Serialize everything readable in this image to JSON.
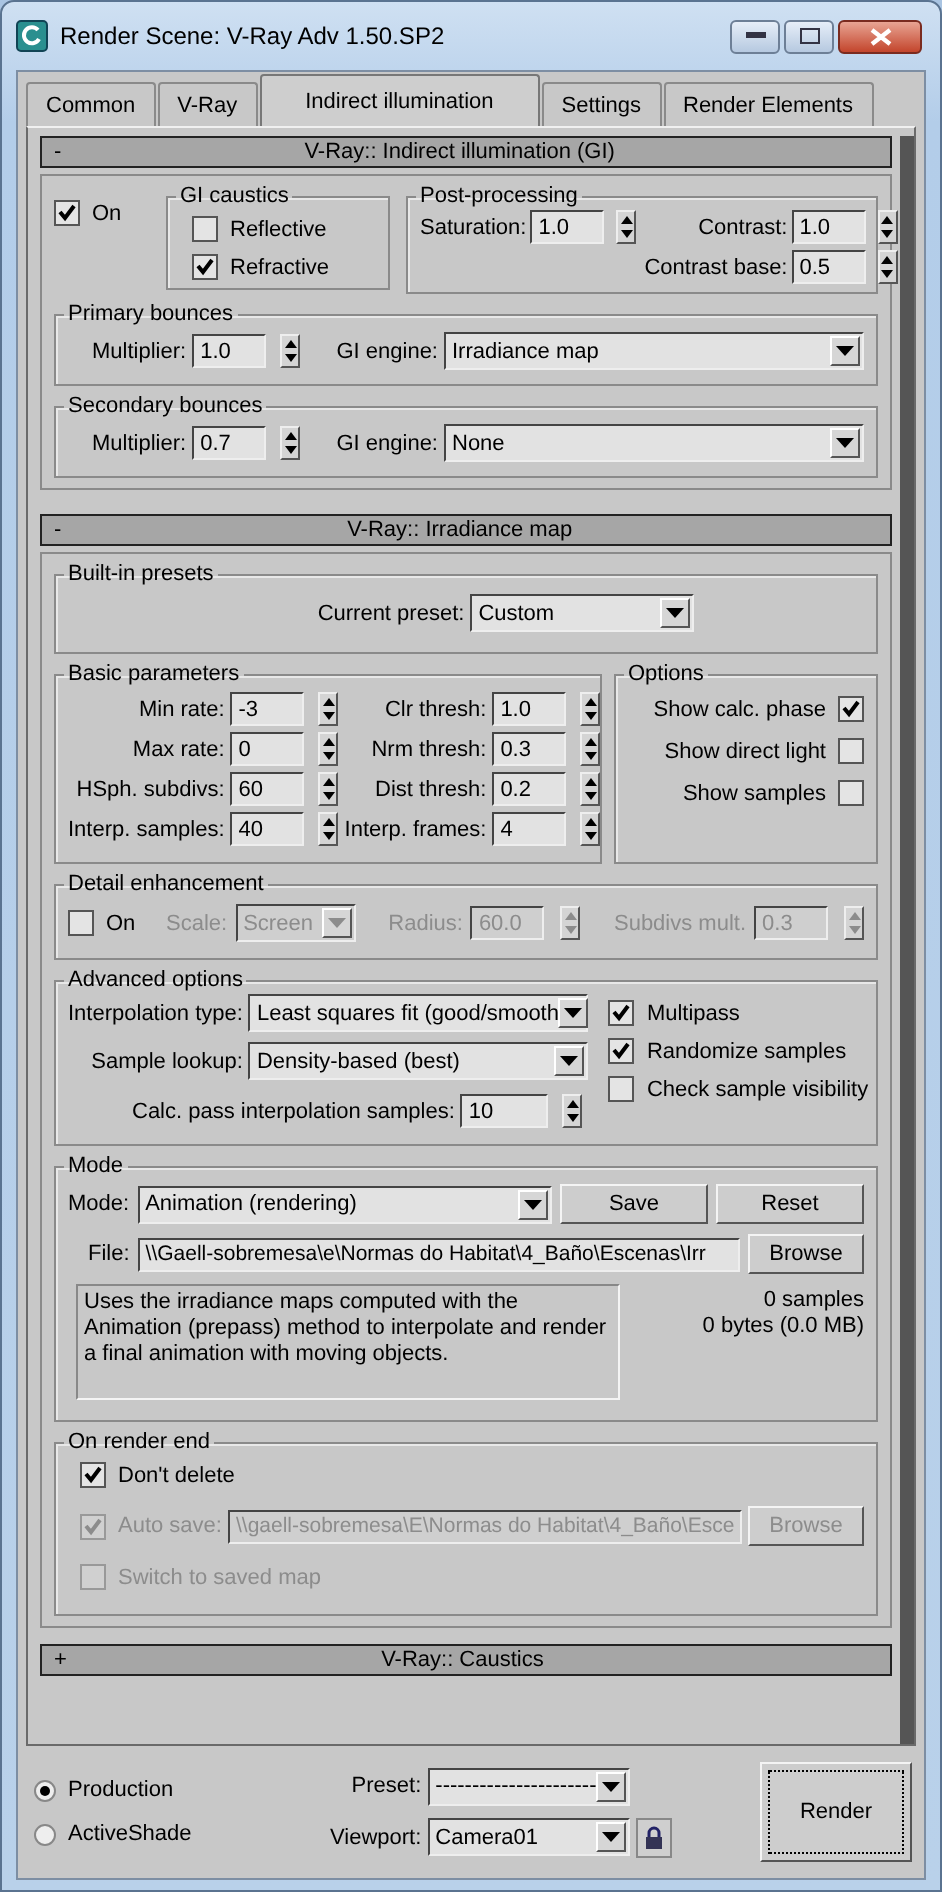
{
  "window": {
    "title": "Render Scene: V-Ray Adv 1.50.SP2"
  },
  "tabs": [
    {
      "label": "Common",
      "selected": false
    },
    {
      "label": "V-Ray",
      "selected": false
    },
    {
      "label": "Indirect illumination",
      "selected": true
    },
    {
      "label": "Settings",
      "selected": false
    },
    {
      "label": "Render Elements",
      "selected": false
    }
  ],
  "gi_rollout": {
    "toggle": "-",
    "title": "V-Ray:: Indirect illumination (GI)",
    "on": {
      "label": "On",
      "checked": true
    },
    "gi_caustics": {
      "title": "GI caustics",
      "options": [
        {
          "label": "Reflective",
          "checked": false
        },
        {
          "label": "Refractive",
          "checked": true
        }
      ]
    },
    "post_processing": {
      "title": "Post-processing",
      "saturation": {
        "label": "Saturation:",
        "value": "1.0"
      },
      "contrast": {
        "label": "Contrast:",
        "value": "1.0"
      },
      "contrast_base": {
        "label": "Contrast base:",
        "value": "0.5"
      }
    },
    "primary_bounces": {
      "title": "Primary bounces",
      "multiplier": {
        "label": "Multiplier:",
        "value": "1.0"
      },
      "engine": {
        "label": "GI engine:",
        "value": "Irradiance map"
      }
    },
    "secondary_bounces": {
      "title": "Secondary bounces",
      "multiplier": {
        "label": "Multiplier:",
        "value": "0.7"
      },
      "engine": {
        "label": "GI engine:",
        "value": "None"
      }
    }
  },
  "irradiance_rollout": {
    "toggle": "-",
    "title": "V-Ray:: Irradiance map",
    "presets": {
      "title": "Built-in presets",
      "current": {
        "label": "Current preset:",
        "value": "Custom"
      }
    },
    "basic": {
      "title": "Basic parameters",
      "left": [
        {
          "label": "Min rate:",
          "value": "-3"
        },
        {
          "label": "Max rate:",
          "value": "0"
        },
        {
          "label": "HSph. subdivs:",
          "value": "60"
        },
        {
          "label": "Interp. samples:",
          "value": "40"
        }
      ],
      "right": [
        {
          "label": "Clr thresh:",
          "value": "1.0"
        },
        {
          "label": "Nrm thresh:",
          "value": "0.3"
        },
        {
          "label": "Dist thresh:",
          "value": "0.2"
        },
        {
          "label": "Interp. frames:",
          "value": "4"
        }
      ]
    },
    "options": {
      "title": "Options",
      "items": [
        {
          "label": "Show calc. phase",
          "checked": true
        },
        {
          "label": "Show direct light",
          "checked": false
        },
        {
          "label": "Show samples",
          "checked": false
        }
      ]
    },
    "detail": {
      "title": "Detail enhancement",
      "on": {
        "label": "On",
        "checked": false
      },
      "scale": {
        "label": "Scale:",
        "value": "Screen",
        "disabled": true
      },
      "radius": {
        "label": "Radius:",
        "value": "60.0",
        "disabled": true
      },
      "subdivs_mult": {
        "label": "Subdivs mult.",
        "value": "0.3",
        "disabled": true
      }
    },
    "advanced": {
      "title": "Advanced options",
      "interpolation_type": {
        "label": "Interpolation type:",
        "value": "Least squares fit (good/smooth"
      },
      "sample_lookup": {
        "label": "Sample lookup:",
        "value": "Density-based (best)"
      },
      "calc_pass": {
        "label": "Calc. pass interpolation samples:",
        "value": "10"
      },
      "checks": [
        {
          "label": "Multipass",
          "checked": true
        },
        {
          "label": "Randomize samples",
          "checked": true
        },
        {
          "label": "Check sample visibility",
          "checked": false
        }
      ]
    },
    "mode": {
      "title": "Mode",
      "mode": {
        "label": "Mode:",
        "value": "Animation (rendering)"
      },
      "buttons": [
        "Save",
        "Reset"
      ],
      "file": {
        "label": "File:",
        "value": "\\\\Gaell-sobremesa\\e\\Normas do Habitat\\4_Baño\\Escenas\\Irr"
      },
      "browse": "Browse",
      "description": "Uses the irradiance maps computed with the Animation (prepass) method to interpolate and render a final animation with moving objects.",
      "samples": "0 samples",
      "bytes": "0 bytes (0.0 MB)"
    },
    "render_end": {
      "title": "On render end",
      "dont_delete": {
        "label": "Don't delete",
        "checked": true
      },
      "auto_save": {
        "label": "Auto save:",
        "checked": true,
        "disabled": true,
        "value": "\\\\gaell-sobremesa\\E\\Normas do Habitat\\4_Baño\\Esce",
        "button": "Browse"
      },
      "switch_map": {
        "label": "Switch to saved map",
        "checked": false,
        "disabled": true
      }
    }
  },
  "caustics_rollout": {
    "toggle": "+",
    "title": "V-Ray:: Caustics"
  },
  "bottom": {
    "modes": [
      {
        "label": "Production",
        "selected": true
      },
      {
        "label": "ActiveShade",
        "selected": false
      }
    ],
    "preset": {
      "label": "Preset:",
      "value": "----------------------"
    },
    "viewport": {
      "label": "Viewport:",
      "value": "Camera01"
    },
    "render": "Render"
  }
}
